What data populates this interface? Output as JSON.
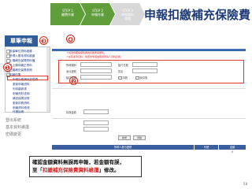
{
  "steps": [
    {
      "line1": "STEP 1",
      "line2": "繳費作業"
    },
    {
      "line1": "STEP 2",
      "line2": "申報作業"
    },
    {
      "line1": "STEP 3",
      "line2": "申報資料",
      "line3": "查詢"
    }
  ],
  "title": "申報扣繳補充保險費",
  "sidebar": {
    "header": "單筆申報",
    "items": [
      "投保單位資料維護",
      "所得人基本資料維護",
      "上傳補充保費資料檔",
      "已上傳待補正資料",
      "已繳補充保費查詢",
      "申報作業",
      "申報扣繳補充保險費",
      "更新申報資料",
      "列印繳款書",
      "申報資料查詢",
      "補充保費試算",
      "更新扣費資料",
      "申報資料修改",
      "作業說明"
    ],
    "links": [
      "登出系統",
      "基本資料維護",
      "密碼變更"
    ]
  },
  "markers": {
    "m1": "❶",
    "m2": "❷",
    "m3": "❸",
    "m4": "❹"
  },
  "form": {
    "notice_1": "＊請選擇補充保險費的扣繳所得類別。",
    "notice_2": "＊如有多筆資料，請逐筆申報並確認所得人資料正確。",
    "income_type_label": "所得類別",
    "income_type_value": "",
    "date_label": "給付日期",
    "date_value": "",
    "id_label": "身分證號",
    "id_value": "",
    "name_label": "姓名",
    "name_value": "",
    "amount_label": "給付金額",
    "amount_value": "",
    "check_1": "扣費",
    "check_2": "免扣費",
    "premium_label": "扣費金額",
    "premium_value": "",
    "submit_label": "新增",
    "clear_label": "清除"
  },
  "table": {
    "headers": [
      "所得人身分證號",
      "代號",
      "金額"
    ],
    "rows": [
      [
        "",
        "",
        "0"
      ]
    ]
  },
  "callout": {
    "line1": "確認金額資料無誤再申報，若金額有誤，",
    "line2_pre": "至「",
    "line2_hl": "扣繳補充保險費資料維護",
    "line2_post": "」修改。"
  },
  "page_number": "58"
}
